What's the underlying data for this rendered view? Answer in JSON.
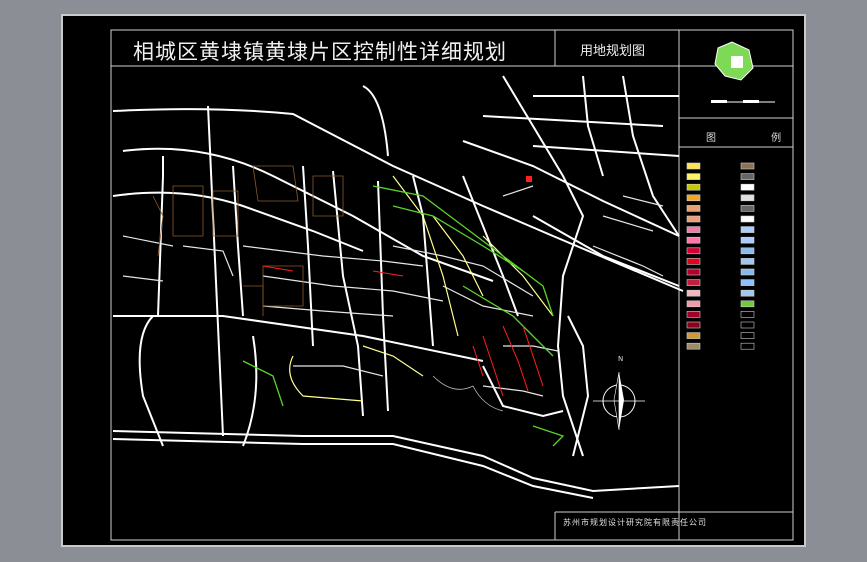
{
  "title": "相城区黄埭镇黄埭片区控制性详细规划",
  "subtitle": "用地规划图",
  "legend_header": "图 例",
  "footer": "苏州市规划设计研究院有限责任公司",
  "north_label": "N",
  "colors": {
    "background": "#000000",
    "frame": "#c9c9c9",
    "road": "#ffffff",
    "road_alt": "#ffff8f",
    "green": "#5bd42a",
    "brown": "#8b5a2b",
    "red": "#ff2020",
    "window": "#8b8f95"
  },
  "legend": {
    "left": [
      "#ffe35b",
      "#fff26b",
      "#c8c800",
      "#f5a623",
      "#e8a070",
      "#e9a07a",
      "#f07aa8",
      "#ff77aa",
      "#d20033",
      "#e30022",
      "#b3002d",
      "#c21f3a",
      "#f5b5c0",
      "#f29aa5",
      "#a0002a",
      "#8f001f",
      "#d19a2e",
      "#9b8c6b"
    ],
    "right": [
      "#8b7355",
      "pattern",
      "#ffffff",
      "#e0e0e0",
      "pattern",
      "#ffffff",
      "#aaccff",
      "#aaccff",
      "#88bbee",
      "#9cc8f0",
      "#88b8e8",
      "#8cc0ff",
      "#a0c8f0",
      "#6ecb3c",
      "#000000",
      "#000000",
      "#000000",
      "#000000"
    ]
  }
}
